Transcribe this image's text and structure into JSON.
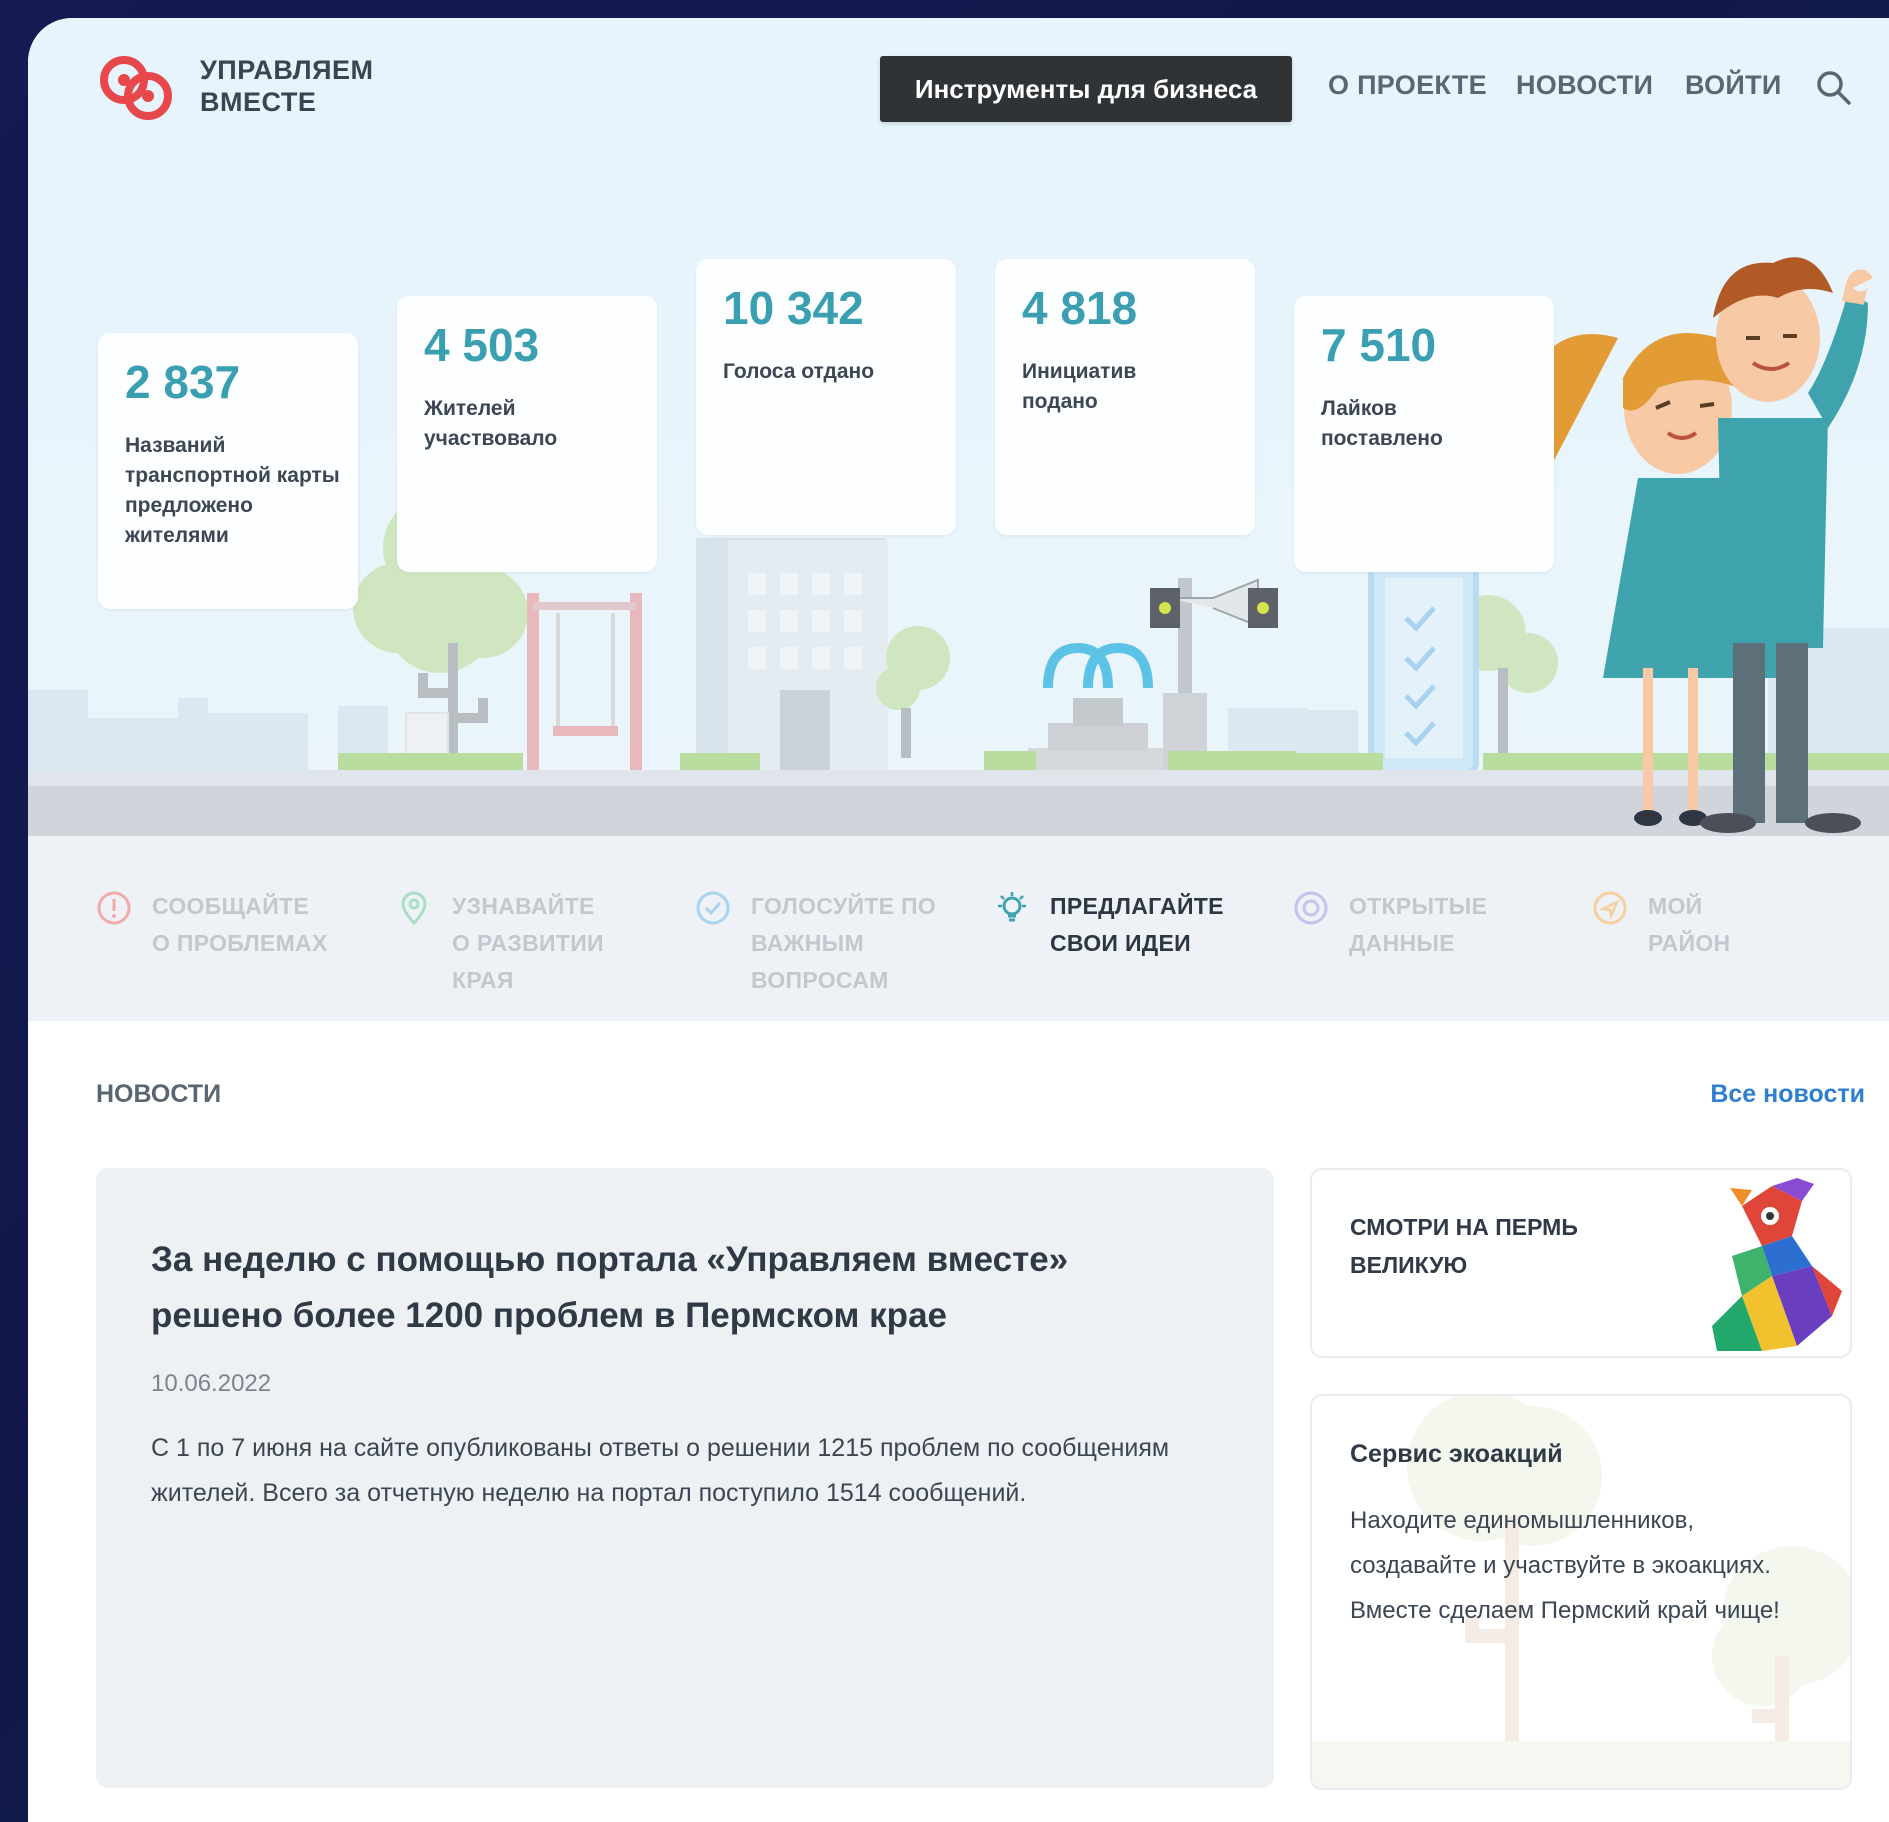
{
  "header": {
    "logo_line1": "УПРАВЛЯЕМ",
    "logo_line2": "ВМЕСТЕ",
    "business_button": "Инструменты для бизнеса",
    "nav": [
      "О ПРОЕКТЕ",
      "НОВОСТИ",
      "ВОЙТИ"
    ]
  },
  "stats": [
    {
      "value": "2 837",
      "label": "Названий транспортной карты предложено жителями"
    },
    {
      "value": "4 503",
      "label": "Жителей участвовало"
    },
    {
      "value": "10 342",
      "label": "Голоса отдано"
    },
    {
      "value": "4 818",
      "label": "Инициатив подано"
    },
    {
      "value": "7 510",
      "label": "Лайков поставлено"
    }
  ],
  "features": [
    {
      "line1": "СООБЩАЙТЕ",
      "line2": "О ПРОБЛЕМАХ",
      "line3": "",
      "icon": "alert-icon",
      "active": false
    },
    {
      "line1": "УЗНАВАЙТЕ",
      "line2": "О РАЗВИТИИ",
      "line3": "КРАЯ",
      "icon": "location-pin-icon",
      "active": false
    },
    {
      "line1": "ГОЛОСУЙТЕ ПО",
      "line2": "ВАЖНЫМ",
      "line3": "ВОПРОСАМ",
      "icon": "check-circle-icon",
      "active": false
    },
    {
      "line1": "ПРЕДЛАГАЙТЕ",
      "line2": "СВОИ ИДЕИ",
      "line3": "",
      "icon": "lightbulb-icon",
      "active": true
    },
    {
      "line1": "ОТКРЫТЫЕ",
      "line2": "ДАННЫЕ",
      "line3": "",
      "icon": "target-icon",
      "active": false
    },
    {
      "line1": "МОЙ",
      "line2": "РАЙОН",
      "line3": "",
      "icon": "navigation-icon",
      "active": false
    }
  ],
  "news": {
    "heading": "НОВОСТИ",
    "all_link": "Все новости",
    "main": {
      "title": "За неделю с помощью портала «Управляем вместе» решено более 1200 проблем в Пермском крае",
      "date": "10.06.2022",
      "body": "С 1 по 7 июня на сайте опубликованы ответы о решении 1215 проблем по сообщениям жителей. Всего за отчетную неделю на портал поступило 1514 сообщений."
    },
    "side1": {
      "title": "СМОТРИ НА ПЕРМЬ ВЕЛИКУЮ"
    },
    "side2": {
      "title": "Сервис экоакций",
      "text": "Находите единомышленников, создавайте и участвуйте в экоакциях. Вместе сделаем Пермский край чище!"
    }
  },
  "colors": {
    "accent_number": "#3a9fb0",
    "link": "#2f7fd0",
    "logo_red": "#e8474c",
    "button_dark": "#2f3336"
  }
}
